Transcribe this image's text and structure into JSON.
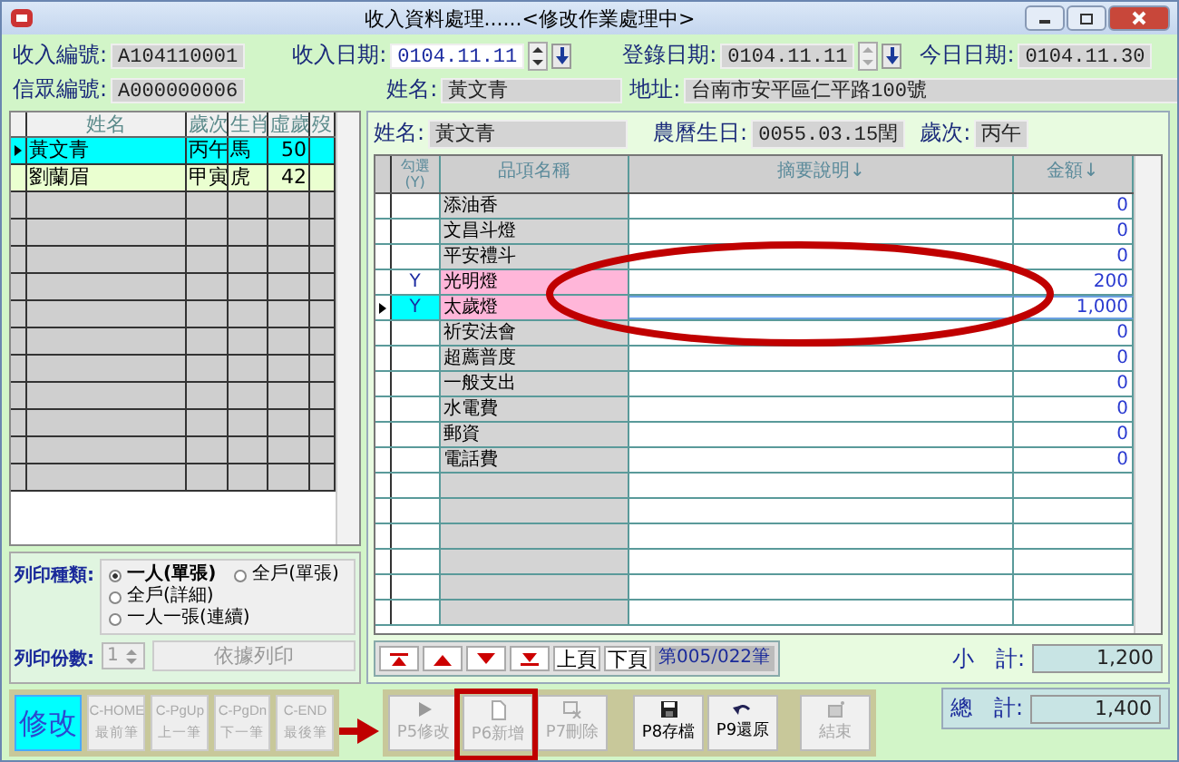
{
  "window": {
    "title": "收入資料處理......<修改作業處理中>"
  },
  "header_row_1": [
    {
      "kind": "readonly",
      "label": "收入編號:",
      "value": "A104110001"
    },
    {
      "kind": "date_edit",
      "label": "收入日期:",
      "value": "0104.11.11"
    },
    {
      "kind": "date_readonly",
      "label": "登錄日期:",
      "value": "0104.11.11"
    },
    {
      "kind": "readonly",
      "label": "今日日期:",
      "value": "0104.11.30"
    }
  ],
  "header_row_2": [
    {
      "kind": "readonly",
      "label": "信眾編號:",
      "value": "A000000006"
    },
    {
      "kind": "readonly",
      "label": "姓名:",
      "value": "黃文青"
    },
    {
      "kind": "wide",
      "label": "地址:",
      "value": "台南市安平區仁平路100號"
    }
  ],
  "people_table": {
    "columns": [
      "姓名",
      "歲次",
      "生肖",
      "虛歲",
      "歿"
    ],
    "rows": [
      {
        "selected": true,
        "cells": [
          "黃文青",
          "丙午",
          "馬",
          "50"
        ]
      },
      {
        "selected": false,
        "cells": [
          "劉蘭眉",
          "甲寅",
          "虎",
          "42"
        ]
      }
    ]
  },
  "detail": {
    "fields": [
      {
        "label": "姓名:",
        "value": "黃文青"
      },
      {
        "label": "農曆生日:",
        "value": "0055.03.15閏"
      },
      {
        "label": "歲次:",
        "value": "丙午"
      }
    ],
    "columns": [
      "勾選 (Y)",
      "品項名稱",
      "摘要說明↓",
      "金額↓"
    ],
    "rows": [
      {
        "checked": false,
        "selected": false,
        "name": "添油香",
        "amount": "0"
      },
      {
        "checked": false,
        "selected": false,
        "name": "文昌斗燈",
        "amount": "0"
      },
      {
        "checked": false,
        "selected": false,
        "name": "平安禮斗",
        "amount": "0"
      },
      {
        "checked": true,
        "selected": false,
        "mark": "Y",
        "name": "光明燈",
        "amount": "200"
      },
      {
        "checked": true,
        "selected": true,
        "mark": "Y",
        "name": "太歲燈",
        "amount": "1,000"
      },
      {
        "checked": false,
        "selected": false,
        "name": "祈安法會",
        "amount": "0"
      },
      {
        "checked": false,
        "selected": false,
        "name": "超薦普度",
        "amount": "0"
      },
      {
        "checked": false,
        "selected": false,
        "name": "一般支出",
        "amount": "0"
      },
      {
        "checked": false,
        "selected": false,
        "name": "水電費",
        "amount": "0"
      },
      {
        "checked": false,
        "selected": false,
        "name": "郵資",
        "amount": "0"
      },
      {
        "checked": false,
        "selected": false,
        "name": "電話費",
        "amount": "0"
      }
    ],
    "nav_buttons": [
      {
        "kind": "first"
      },
      {
        "kind": "prev"
      },
      {
        "kind": "next"
      },
      {
        "kind": "last"
      },
      {
        "kind": "text",
        "label": "上頁"
      },
      {
        "kind": "text",
        "label": "下頁"
      }
    ],
    "record": "第005/022筆",
    "subtotal": {
      "label": "小　計:",
      "value": "1,200"
    }
  },
  "print": {
    "type_label": "列印種類:",
    "options": [
      {
        "label": "一人(單張)",
        "selected": true
      },
      {
        "label": "全戶(單張)",
        "selected": false
      },
      {
        "label": "全戶(詳細)",
        "selected": false
      },
      {
        "label": "一人一張(連續)",
        "selected": false
      }
    ],
    "copies_label": "列印份數:",
    "copies": "1",
    "button": "依據列印"
  },
  "left_buttons": [
    {
      "kind": "mode",
      "lines": [
        "修改"
      ]
    },
    {
      "kind": "nav",
      "lines": [
        "C-HOME",
        "最前筆"
      ],
      "disabled": true
    },
    {
      "kind": "nav",
      "lines": [
        "C-PgUp",
        "上一筆"
      ],
      "disabled": true
    },
    {
      "kind": "nav",
      "lines": [
        "C-PgDn",
        "下一筆"
      ],
      "disabled": true
    },
    {
      "kind": "nav",
      "lines": [
        "C-END",
        "最後筆"
      ],
      "disabled": true
    }
  ],
  "action_buttons": [
    {
      "kind": "edit",
      "label": "P5修改",
      "disabled": true
    },
    {
      "kind": "new",
      "label": "P6新增",
      "disabled": true
    },
    {
      "kind": "delete",
      "label": "P7刪除",
      "disabled": true
    },
    {
      "kind": "save",
      "label": "P8存檔",
      "disabled": false
    },
    {
      "kind": "undo",
      "label": "P9還原",
      "disabled": false
    },
    {
      "kind": "exit",
      "label": "結束",
      "disabled": true
    }
  ],
  "total": {
    "label": "總　計:",
    "value": "1,400"
  }
}
